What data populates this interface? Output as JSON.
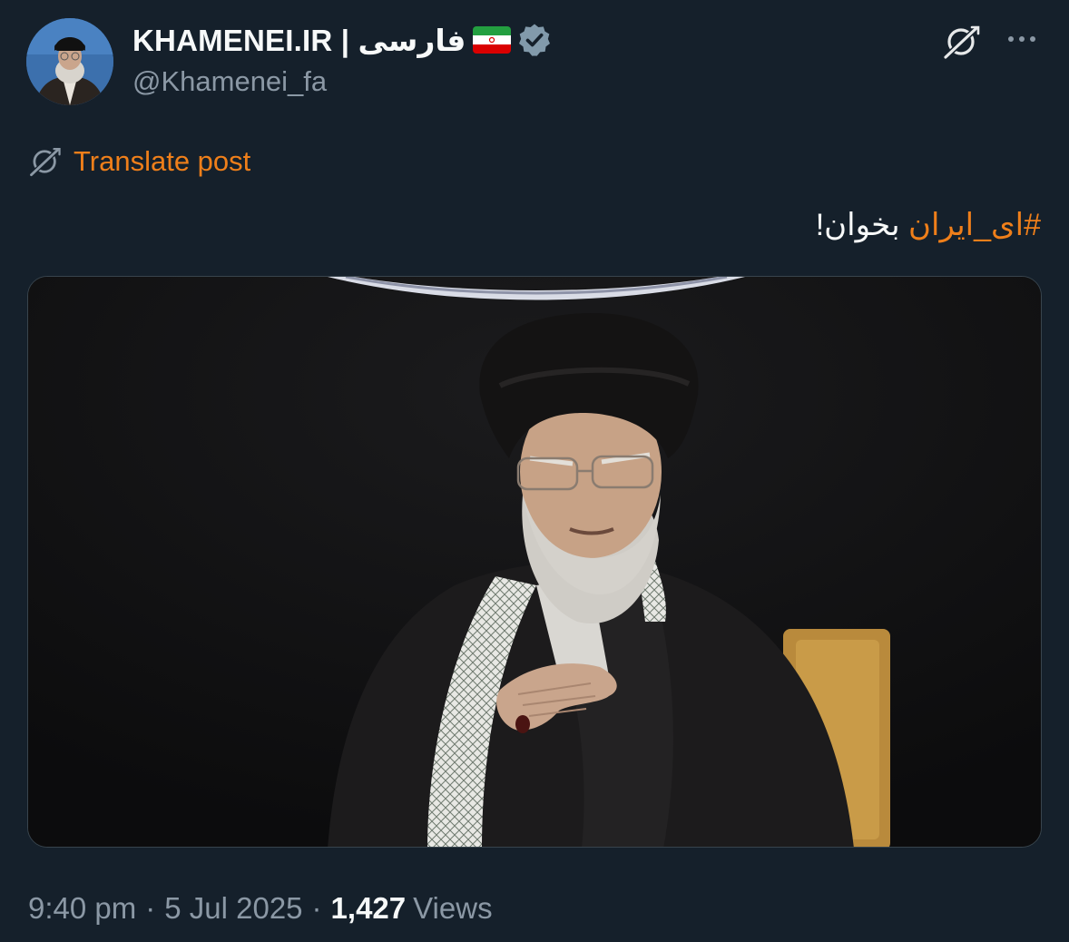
{
  "author": {
    "display_name": "KHAMENEI.IR | فارسی",
    "handle": "@Khamenei_fa",
    "verified": true,
    "avatar_icon": "profile-portrait",
    "flag_icon": "iran-flag-icon"
  },
  "translate": {
    "label": "Translate post"
  },
  "post": {
    "hashtag": "#ای_ایران",
    "text": " بخوان!",
    "media_description_icon": "video-still"
  },
  "meta": {
    "time": "9:40 pm",
    "date": "5 Jul 2025",
    "views_count": "1,427",
    "views_label": "Views"
  },
  "colors": {
    "background": "#15202b",
    "accent": "#ef7f1a",
    "secondary_text": "#8b98a5",
    "verified_badge": "#829aab"
  }
}
